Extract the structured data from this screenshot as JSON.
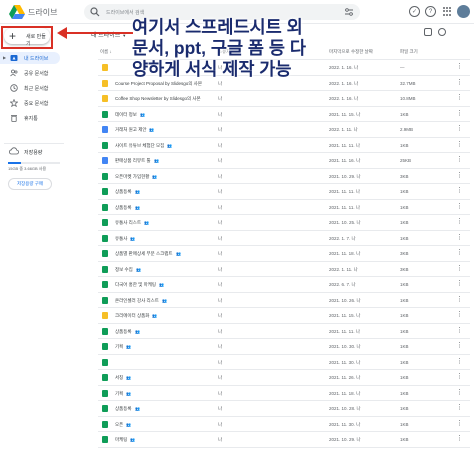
{
  "header": {
    "app_name": "드라이브",
    "search_placeholder": "드라이브에서 검색"
  },
  "sidebar": {
    "new_button": "새로 만들기",
    "items": [
      {
        "label": "내 드라이브",
        "icon": "my-drive-icon",
        "active": true
      },
      {
        "label": "공유 문서함",
        "icon": "shared-icon",
        "active": false
      },
      {
        "label": "최근 문서함",
        "icon": "clock-icon",
        "active": false
      },
      {
        "label": "중요 문서함",
        "icon": "star-icon",
        "active": false
      },
      {
        "label": "휴지통",
        "icon": "trash-icon",
        "active": false
      }
    ],
    "storage_label": "저장용량",
    "storage_text": "15GB 중 3.66GB 사용",
    "storage_fraction": 0.244,
    "buy_button": "저장용량 구매"
  },
  "breadcrumb": "내 드라이브",
  "columns": {
    "name": "이름",
    "owner": "소유자",
    "modified": "마지막으로 수정한 날짜",
    "size": "파일 크기"
  },
  "annotation": "여기서 스프레드시트 외 문서, ppt, 구글 폼 등 다양하게 서식 제작 가능",
  "colors": {
    "folder": "#f6bf26",
    "sheet": "#0f9d58",
    "doc": "#4285f4",
    "annotation": "#1a2b6e",
    "highlight": "#d93025"
  },
  "files": [
    {
      "type": "folder",
      "name": "",
      "shared": false,
      "owner": "나",
      "date": "2022. 1. 16. 나",
      "size": "—"
    },
    {
      "type": "folder",
      "name": "Course Project Proposal by Slidesgo의 사본",
      "shared": false,
      "owner": "나",
      "date": "2022. 1. 16. 나",
      "size": "32.7MB"
    },
    {
      "type": "folder",
      "name": "Coffee Shop Newsletter by Slidesgo의 사본",
      "shared": false,
      "owner": "나",
      "date": "2022. 1. 16. 나",
      "size": "10.8MB"
    },
    {
      "type": "sheet",
      "name": "데이터 정보",
      "shared": true,
      "owner": "나",
      "date": "2021. 11. 15. 나",
      "size": "1KB"
    },
    {
      "type": "doc",
      "name": "거래처 원고 제안",
      "shared": true,
      "owner": "나",
      "date": "2022. 1. 11. 나",
      "size": "2.9MB"
    },
    {
      "type": "sheet",
      "name": "사이트 유튜브 체험단 모집",
      "shared": true,
      "owner": "나",
      "date": "2021. 11. 11. 나",
      "size": "1KB"
    },
    {
      "type": "doc",
      "name": "판매상품 리뷰트 툴",
      "shared": true,
      "owner": "나",
      "date": "2021. 11. 16. 나",
      "size": "25KB"
    },
    {
      "type": "sheet",
      "name": "오픈마켓 가입현황",
      "shared": true,
      "owner": "나",
      "date": "2021. 10. 29. 나",
      "size": "3KB"
    },
    {
      "type": "sheet",
      "name": "상품등록",
      "shared": true,
      "owner": "나",
      "date": "2021. 11. 11. 나",
      "size": "1KB"
    },
    {
      "type": "sheet",
      "name": "상품등록",
      "shared": true,
      "owner": "나",
      "date": "2021. 11. 11. 나",
      "size": "1KB"
    },
    {
      "type": "sheet",
      "name": "유통사 리스트",
      "shared": true,
      "owner": "나",
      "date": "2021. 10. 25. 나",
      "size": "1KB"
    },
    {
      "type": "sheet",
      "name": "유통사",
      "shared": true,
      "owner": "나",
      "date": "2022. 1. 7. 나",
      "size": "1KB"
    },
    {
      "type": "sheet",
      "name": "상품별 판매상세 부분 스크랩트",
      "shared": true,
      "owner": "나",
      "date": "2021. 11. 18. 나",
      "size": "3KB"
    },
    {
      "type": "sheet",
      "name": "정보 수집",
      "shared": true,
      "owner": "나",
      "date": "2022. 1. 11. 나",
      "size": "3KB"
    },
    {
      "type": "sheet",
      "name": "다국어 홍한 및 마케팅",
      "shared": true,
      "owner": "나",
      "date": "2022. 6. 7. 나",
      "size": "1KB"
    },
    {
      "type": "sheet",
      "name": "온라인셀러 강사 리스트",
      "shared": true,
      "owner": "나",
      "date": "2021. 10. 26. 나",
      "size": "1KB"
    },
    {
      "type": "folder",
      "name": "크리에이터 상품화",
      "shared": true,
      "owner": "나",
      "date": "2021. 11. 15. 나",
      "size": "1KB"
    },
    {
      "type": "sheet",
      "name": "상품등록",
      "shared": true,
      "owner": "나",
      "date": "2021. 11. 11. 나",
      "size": "1KB"
    },
    {
      "type": "sheet",
      "name": "기획",
      "shared": true,
      "owner": "나",
      "date": "2021. 10. 30. 나",
      "size": "1KB"
    },
    {
      "type": "sheet",
      "name": "",
      "shared": false,
      "owner": "나",
      "date": "2021. 11. 30. 나",
      "size": "1KB"
    },
    {
      "type": "sheet",
      "name": "서칭",
      "shared": true,
      "owner": "나",
      "date": "2021. 11. 26. 나",
      "size": "1KB"
    },
    {
      "type": "sheet",
      "name": "기획",
      "shared": true,
      "owner": "나",
      "date": "2021. 11. 18. 나",
      "size": "1KB"
    },
    {
      "type": "sheet",
      "name": "상품등록",
      "shared": true,
      "owner": "나",
      "date": "2021. 10. 28. 나",
      "size": "1KB"
    },
    {
      "type": "sheet",
      "name": "오픈",
      "shared": true,
      "owner": "나",
      "date": "2021. 11. 30. 나",
      "size": "1KB"
    },
    {
      "type": "sheet",
      "name": "마케팅",
      "shared": true,
      "owner": "나",
      "date": "2021. 10. 29. 나",
      "size": "1KB"
    },
    {
      "type": "sheet",
      "name": "상품등록",
      "shared": true,
      "owner": "나",
      "date": "2021. 11. 24. 나",
      "size": "1KB"
    }
  ]
}
